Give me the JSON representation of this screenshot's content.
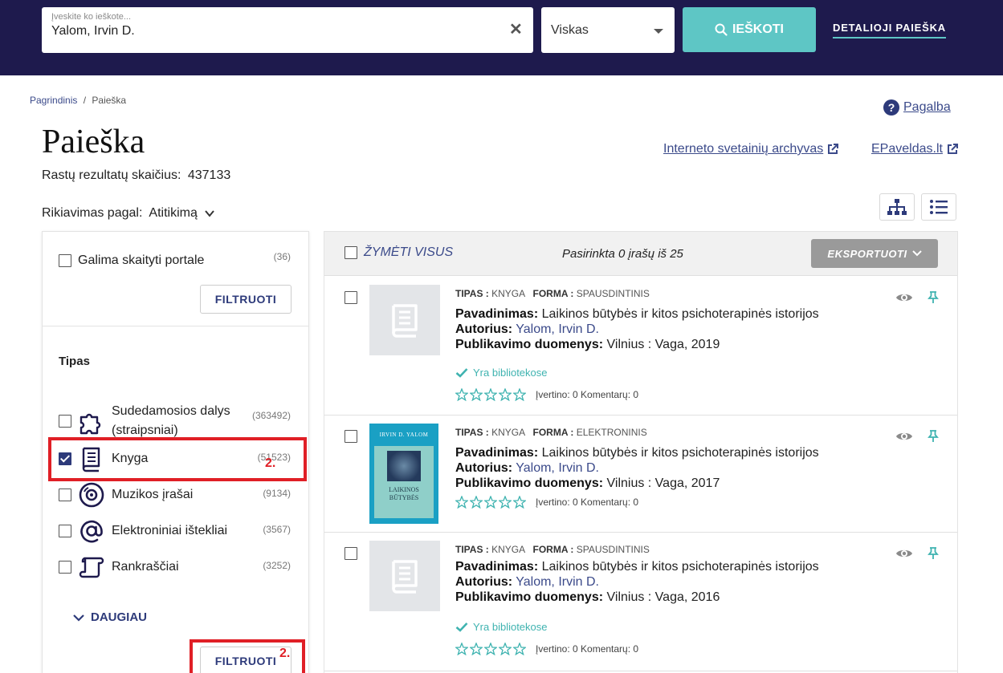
{
  "header": {
    "search_placeholder": "Įveskite ko ieškote...",
    "search_value": "Yalom, Irvin D.",
    "scope_value": "Viskas",
    "search_button": "IEŠKOTI",
    "advanced_link": "DETALIOJI PAIEŠKA"
  },
  "breadcrumb": {
    "home": "Pagrindinis",
    "sep": "/",
    "current": "Paieška"
  },
  "help_link": "Pagalba",
  "page_title": "Paieška",
  "results_count_label": "Rastų rezultatų skaičius:",
  "results_count_value": "437133",
  "links": {
    "archive": "Interneto svetainių archyvas",
    "epaveldas": "EPaveldas.lt"
  },
  "sort": {
    "label": "Rikiavimas pagal:",
    "value": "Atitikimą"
  },
  "sidebar": {
    "portal_filter": {
      "label": "Galima skaityti portale",
      "count": "(36)"
    },
    "filter_button": "FILTRUOTI",
    "type_heading": "Tipas",
    "types": [
      {
        "label_line1": "Sudedamosios dalys",
        "label_line2": "(straipsniai)",
        "count": "(363492)",
        "icon": "puzzle-icon",
        "checked": false
      },
      {
        "label": "Knyga",
        "count": "(51523)",
        "icon": "book-icon",
        "checked": true
      },
      {
        "label": "Muzikos įrašai",
        "count": "(9134)",
        "icon": "disc-icon",
        "checked": false
      },
      {
        "label": "Elektroniniai ištekliai",
        "count": "(3567)",
        "icon": "at-icon",
        "checked": false
      },
      {
        "label": "Rankraščiai",
        "count": "(3252)",
        "icon": "scroll-icon",
        "checked": false
      }
    ],
    "more_link": "DAUGIAU",
    "annotation": "2."
  },
  "results": {
    "mark_all": "ŽYMĖTI VISUS",
    "selected_info": "Pasirinkta 0 įrašų iš 25",
    "export_button": "EKSPORTUOTI",
    "type_label": "TIPAS :",
    "form_label": "FORMA :",
    "title_label": "Pavadinimas:",
    "author_label": "Autorius:",
    "pub_label": "Publikavimo duomenys:",
    "available_text": "Yra bibliotekose",
    "rating_text": "Įvertino: 0 Komentarų: 0",
    "items": [
      {
        "type": "KNYGA",
        "form": "SPAUSDINTINIS",
        "title": "Laikinos būtybės ir kitos psichoterapinės istorijos",
        "author": "Yalom, Irvin D.",
        "pub": "Vilnius : Vaga, 2019"
      },
      {
        "type": "KNYGA",
        "form": "ELEKTRONINIS",
        "title": "Laikinos būtybės ir kitos psichoterapinės istorijos",
        "author": "Yalom, Irvin D.",
        "pub": "Vilnius : Vaga, 2017",
        "cover_author": "IRVIN D. YALOM",
        "cover_title_1": "LAIKINOS",
        "cover_title_2": "BŪTYBĖS"
      },
      {
        "type": "KNYGA",
        "form": "SPAUSDINTINIS",
        "title": "Laikinos būtybės ir kitos psichoterapinės istorijos",
        "author": "Yalom, Irvin D.",
        "pub": "Vilnius : Vaga, 2016"
      }
    ]
  },
  "colors": {
    "header_bg": "#1e1a4d",
    "accent": "#5ec6c5",
    "link": "#3b4a8a",
    "highlight": "#e01f26"
  }
}
